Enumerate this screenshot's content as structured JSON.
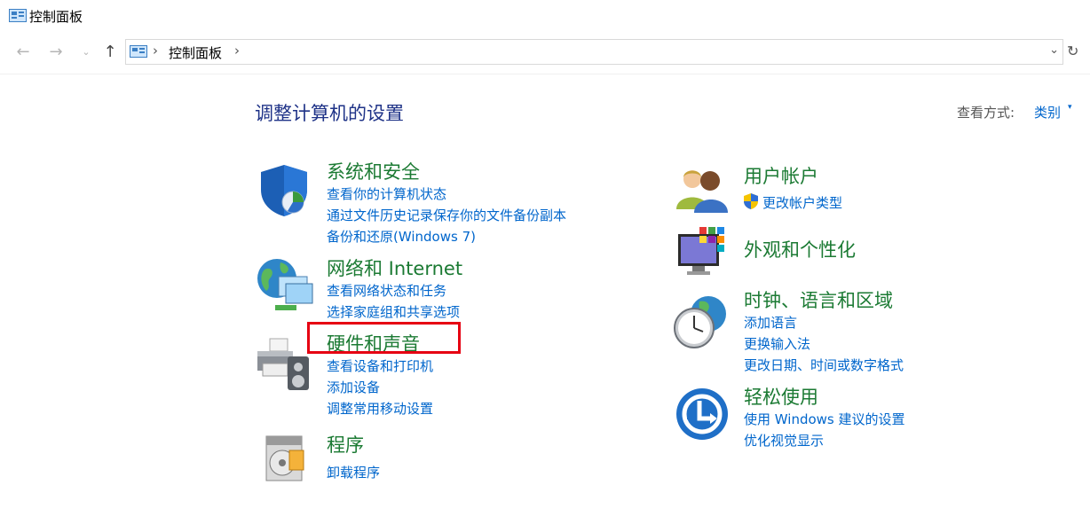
{
  "window": {
    "title": "控制面板"
  },
  "nav": {
    "back_icon": "back-arrow-icon",
    "forward_icon": "forward-arrow-icon",
    "recent_icon": "chevron-down-icon",
    "up_icon": "up-arrow-icon",
    "address": {
      "crumb": "控制面板",
      "separator": "›"
    },
    "refresh_icon": "refresh-icon"
  },
  "header": {
    "title": "调整计算机的设置",
    "view_by_label": "查看方式:",
    "view_by_value": "类别"
  },
  "categories": {
    "system_security": {
      "title": "系统和安全",
      "links": [
        "查看你的计算机状态",
        "通过文件历史记录保存你的文件备份副本",
        "备份和还原(Windows 7)"
      ]
    },
    "network": {
      "title": "网络和 Internet",
      "links": [
        "查看网络状态和任务",
        "选择家庭组和共享选项"
      ]
    },
    "hardware_sound": {
      "title": "硬件和声音",
      "links": [
        "查看设备和打印机",
        "添加设备",
        "调整常用移动设置"
      ]
    },
    "programs": {
      "title": "程序",
      "links": [
        "卸载程序"
      ]
    },
    "user_accounts": {
      "title": "用户帐户",
      "links": [
        "更改帐户类型"
      ]
    },
    "appearance": {
      "title": "外观和个性化",
      "links": []
    },
    "clock_region": {
      "title": "时钟、语言和区域",
      "links": [
        "添加语言",
        "更换输入法",
        "更改日期、时间或数字格式"
      ]
    },
    "ease_of_access": {
      "title": "轻松使用",
      "links": [
        "使用 Windows 建议的设置",
        "优化视觉显示"
      ]
    }
  },
  "colors": {
    "category_title": "#1b7a33",
    "link": "#0066cc",
    "page_title": "#1e3287",
    "highlight": "#e60012"
  }
}
